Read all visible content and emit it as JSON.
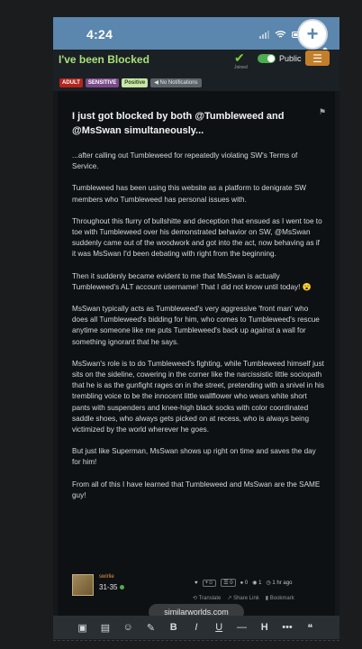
{
  "status": {
    "time": "4:24"
  },
  "header": {
    "title": "I've been Blocked",
    "joined_label": "Joined",
    "public_label": "Public",
    "menu_icon": "hamburger-icon",
    "tags": [
      "ADULT",
      "SENSITIVE",
      "Positive",
      "No Notifications"
    ]
  },
  "post": {
    "headline": "I just got blocked by both @Tumbleweed and @MsSwan simultaneously...",
    "paragraphs": [
      "...after calling out Tumbleweed for repeatedly violating SW's Terms of Service.",
      "Tumbleweed has been using this website as a platform to denigrate SW members who Tumbleweed has personal issues with.",
      "Throughout this flurry of bullshitte and deception that ensued as I went toe to toe with Tumbleweed over his demonstrated behavior on SW, @MsSwan suddenly came out of the woodwork and got into the act, now behaving as if it was MsSwan I'd been debating with right from the beginning.",
      "Then it suddenly became evident to me that MsSwan is actually Tumbleweed's ALT account username! That I did not know until today! 😮",
      "MsSwan typically acts as Tumbleweed's very aggressive 'front man' who does all Tumbleweed's bidding for him, who comes to Tumbleweed's rescue anytime someone like me puts Tumbleweed's back up against a wall for something ignorant that he says.",
      "MsSwan's role is to do Tumbleweed's fighting, while Tumbleweed himself just sits on the sideline, cowering in the corner like the narcissistic little sociopath that he is as the gunfight rages on in the street, pretending with a snivel in his trembling voice to be the innocent little wallflower who wears white short pants with suspenders and knee-high black socks with color coordinated saddle shoes, who always gets picked on at recess, who is always being victimized by the world wherever he goes.",
      "But just like Superman, MsSwan shows up right on time and saves the day for him!",
      "From all of this I have learned that Tumbleweed and MsSwan are the SAME guy!"
    ],
    "author": {
      "username": "swirlie",
      "age": "31-35"
    },
    "stats": {
      "likes": "0",
      "comments": "0",
      "eye": "1",
      "time": "1 hr ago"
    },
    "actions": {
      "translate": "Translate",
      "share": "Share Link",
      "bookmark": "Bookmark"
    }
  },
  "watermark": "similarworlds.com",
  "toolbar": [
    "image-icon",
    "video-icon",
    "emoji-icon",
    "pen-icon",
    "bold-icon",
    "italic-icon",
    "underline-icon",
    "strike-icon",
    "heading-icon",
    "more-icon",
    "quote-icon"
  ]
}
